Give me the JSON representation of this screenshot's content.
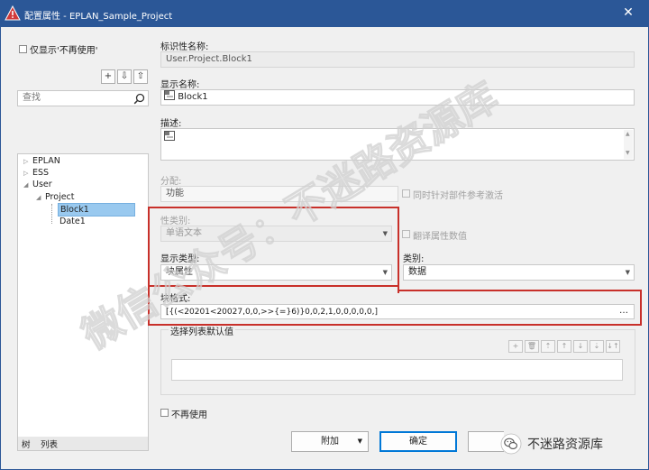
{
  "window": {
    "title": "配置属性 - EPLAN_Sample_Project",
    "close_glyph": "✕"
  },
  "left_panel": {
    "show_unused_label": "仅显示'不再使用'",
    "toolbar": {
      "add": "+",
      "import": "⇩",
      "export": "⇧"
    },
    "search": {
      "placeholder": "查找"
    },
    "tree": [
      {
        "label": "EPLAN",
        "level": 0,
        "arrow": "▷"
      },
      {
        "label": "ESS",
        "level": 0,
        "arrow": "▷"
      },
      {
        "label": "User",
        "level": 0,
        "arrow": "◢"
      },
      {
        "label": "Project",
        "level": 1,
        "arrow": "◢"
      },
      {
        "label": "Block1",
        "level": 2,
        "selected": true
      },
      {
        "label": "Date1",
        "level": 2
      }
    ],
    "tabs": {
      "tree": "树",
      "list": "列表"
    }
  },
  "main": {
    "id_name_label": "标识性名称:",
    "id_name_value": "User.Project.Block1",
    "display_name_label": "显示名称:",
    "display_name_value": "Block1",
    "description_label": "描述:",
    "assignment_label": "分配:",
    "assignment_value": "功能",
    "activate_ref_label": "同时针对部件参考激活",
    "attr_category_label": "性类别:",
    "attr_category_value": "单语文本",
    "translate_label": "翻译属性数值",
    "display_type_label": "显示类型:",
    "display_type_value": "块属性",
    "category_label": "类别:",
    "category_value": "数据",
    "format_label": "块格式:",
    "format_value": "[{(<20201<20027,0,0,>>{=}6)}0,0,2,1,0,0,0,0,0,]",
    "list_default_label": "选择列表默认值",
    "no_longer_used_label": "不再使用"
  },
  "list_toolbar": [
    "+",
    "🗑",
    "⇡",
    "↑",
    "↓",
    "⇣",
    "↓↑"
  ],
  "buttons": {
    "append": "附加",
    "ok": "确定"
  },
  "overlay": {
    "watermark": "微信公众号：不迷路资源库",
    "badge": "不迷路资源库"
  },
  "colors": {
    "titlebar": "#2b5797",
    "highlight_box": "#c8302a",
    "selection": "#99c9ef"
  }
}
